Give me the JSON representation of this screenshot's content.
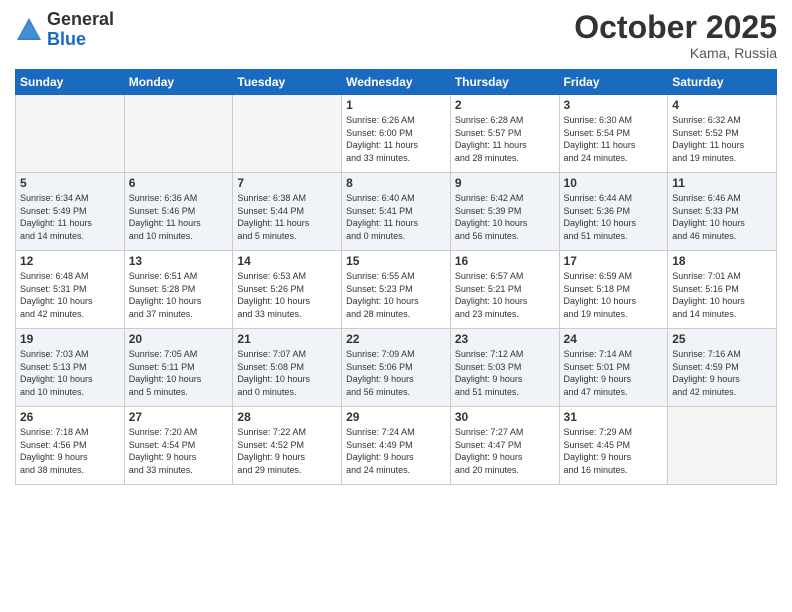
{
  "header": {
    "logo_general": "General",
    "logo_blue": "Blue",
    "month_title": "October 2025",
    "location": "Kama, Russia"
  },
  "columns": [
    "Sunday",
    "Monday",
    "Tuesday",
    "Wednesday",
    "Thursday",
    "Friday",
    "Saturday"
  ],
  "weeks": [
    [
      {
        "day": "",
        "info": ""
      },
      {
        "day": "",
        "info": ""
      },
      {
        "day": "",
        "info": ""
      },
      {
        "day": "1",
        "info": "Sunrise: 6:26 AM\nSunset: 6:00 PM\nDaylight: 11 hours\nand 33 minutes."
      },
      {
        "day": "2",
        "info": "Sunrise: 6:28 AM\nSunset: 5:57 PM\nDaylight: 11 hours\nand 28 minutes."
      },
      {
        "day": "3",
        "info": "Sunrise: 6:30 AM\nSunset: 5:54 PM\nDaylight: 11 hours\nand 24 minutes."
      },
      {
        "day": "4",
        "info": "Sunrise: 6:32 AM\nSunset: 5:52 PM\nDaylight: 11 hours\nand 19 minutes."
      }
    ],
    [
      {
        "day": "5",
        "info": "Sunrise: 6:34 AM\nSunset: 5:49 PM\nDaylight: 11 hours\nand 14 minutes."
      },
      {
        "day": "6",
        "info": "Sunrise: 6:36 AM\nSunset: 5:46 PM\nDaylight: 11 hours\nand 10 minutes."
      },
      {
        "day": "7",
        "info": "Sunrise: 6:38 AM\nSunset: 5:44 PM\nDaylight: 11 hours\nand 5 minutes."
      },
      {
        "day": "8",
        "info": "Sunrise: 6:40 AM\nSunset: 5:41 PM\nDaylight: 11 hours\nand 0 minutes."
      },
      {
        "day": "9",
        "info": "Sunrise: 6:42 AM\nSunset: 5:39 PM\nDaylight: 10 hours\nand 56 minutes."
      },
      {
        "day": "10",
        "info": "Sunrise: 6:44 AM\nSunset: 5:36 PM\nDaylight: 10 hours\nand 51 minutes."
      },
      {
        "day": "11",
        "info": "Sunrise: 6:46 AM\nSunset: 5:33 PM\nDaylight: 10 hours\nand 46 minutes."
      }
    ],
    [
      {
        "day": "12",
        "info": "Sunrise: 6:48 AM\nSunset: 5:31 PM\nDaylight: 10 hours\nand 42 minutes."
      },
      {
        "day": "13",
        "info": "Sunrise: 6:51 AM\nSunset: 5:28 PM\nDaylight: 10 hours\nand 37 minutes."
      },
      {
        "day": "14",
        "info": "Sunrise: 6:53 AM\nSunset: 5:26 PM\nDaylight: 10 hours\nand 33 minutes."
      },
      {
        "day": "15",
        "info": "Sunrise: 6:55 AM\nSunset: 5:23 PM\nDaylight: 10 hours\nand 28 minutes."
      },
      {
        "day": "16",
        "info": "Sunrise: 6:57 AM\nSunset: 5:21 PM\nDaylight: 10 hours\nand 23 minutes."
      },
      {
        "day": "17",
        "info": "Sunrise: 6:59 AM\nSunset: 5:18 PM\nDaylight: 10 hours\nand 19 minutes."
      },
      {
        "day": "18",
        "info": "Sunrise: 7:01 AM\nSunset: 5:16 PM\nDaylight: 10 hours\nand 14 minutes."
      }
    ],
    [
      {
        "day": "19",
        "info": "Sunrise: 7:03 AM\nSunset: 5:13 PM\nDaylight: 10 hours\nand 10 minutes."
      },
      {
        "day": "20",
        "info": "Sunrise: 7:05 AM\nSunset: 5:11 PM\nDaylight: 10 hours\nand 5 minutes."
      },
      {
        "day": "21",
        "info": "Sunrise: 7:07 AM\nSunset: 5:08 PM\nDaylight: 10 hours\nand 0 minutes."
      },
      {
        "day": "22",
        "info": "Sunrise: 7:09 AM\nSunset: 5:06 PM\nDaylight: 9 hours\nand 56 minutes."
      },
      {
        "day": "23",
        "info": "Sunrise: 7:12 AM\nSunset: 5:03 PM\nDaylight: 9 hours\nand 51 minutes."
      },
      {
        "day": "24",
        "info": "Sunrise: 7:14 AM\nSunset: 5:01 PM\nDaylight: 9 hours\nand 47 minutes."
      },
      {
        "day": "25",
        "info": "Sunrise: 7:16 AM\nSunset: 4:59 PM\nDaylight: 9 hours\nand 42 minutes."
      }
    ],
    [
      {
        "day": "26",
        "info": "Sunrise: 7:18 AM\nSunset: 4:56 PM\nDaylight: 9 hours\nand 38 minutes."
      },
      {
        "day": "27",
        "info": "Sunrise: 7:20 AM\nSunset: 4:54 PM\nDaylight: 9 hours\nand 33 minutes."
      },
      {
        "day": "28",
        "info": "Sunrise: 7:22 AM\nSunset: 4:52 PM\nDaylight: 9 hours\nand 29 minutes."
      },
      {
        "day": "29",
        "info": "Sunrise: 7:24 AM\nSunset: 4:49 PM\nDaylight: 9 hours\nand 24 minutes."
      },
      {
        "day": "30",
        "info": "Sunrise: 7:27 AM\nSunset: 4:47 PM\nDaylight: 9 hours\nand 20 minutes."
      },
      {
        "day": "31",
        "info": "Sunrise: 7:29 AM\nSunset: 4:45 PM\nDaylight: 9 hours\nand 16 minutes."
      },
      {
        "day": "",
        "info": ""
      }
    ]
  ]
}
